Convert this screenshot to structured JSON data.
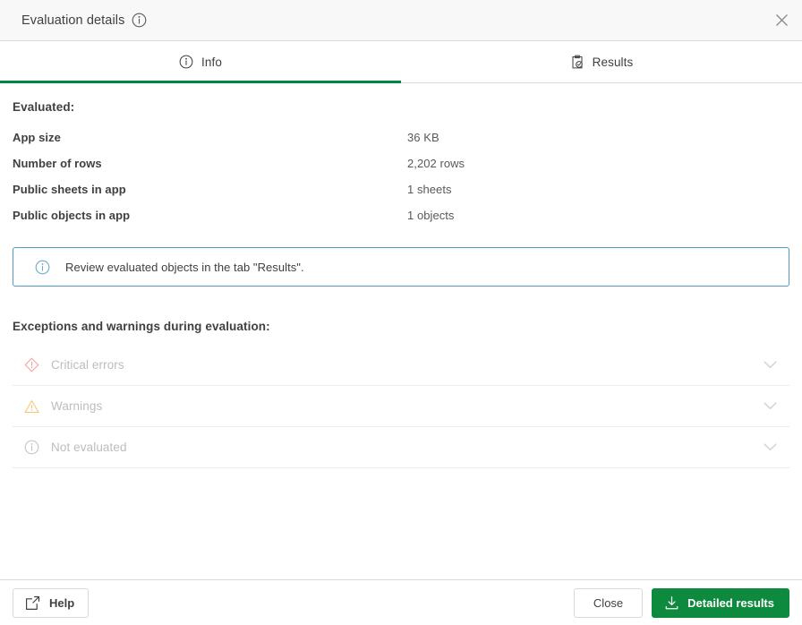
{
  "header": {
    "title": "Evaluation details",
    "info_icon": "info-circle-icon",
    "close_icon": "close-icon"
  },
  "tabs": [
    {
      "label": "Info",
      "icon": "info-circle-icon",
      "active": true
    },
    {
      "label": "Results",
      "icon": "clipboard-check-icon",
      "active": false
    }
  ],
  "main": {
    "evaluated_title": "Evaluated:",
    "metrics": [
      {
        "key": "App size",
        "value": "36 KB"
      },
      {
        "key": "Number of rows",
        "value": "2,202 rows"
      },
      {
        "key": "Public sheets in app",
        "value": "1 sheets"
      },
      {
        "key": "Public objects in app",
        "value": "1 objects"
      }
    ],
    "banner": {
      "icon": "info-circle-icon",
      "text": "Review evaluated objects in the tab \"Results\".",
      "border_color": "#4e9dc4"
    },
    "exceptions_title": "Exceptions and warnings during evaluation:",
    "accordion": [
      {
        "label": "Critical errors",
        "icon": "diamond-alert-icon",
        "icon_color": "#f4a0a0",
        "chevron": "chevron-down-icon"
      },
      {
        "label": "Warnings",
        "icon": "triangle-warning-icon",
        "icon_color": "#f7c66b",
        "chevron": "chevron-down-icon"
      },
      {
        "label": "Not evaluated",
        "icon": "info-circle-icon",
        "icon_color": "#c4c4c4",
        "chevron": "chevron-down-icon"
      }
    ]
  },
  "footer": {
    "help_label": "Help",
    "help_icon": "external-link-icon",
    "close_label": "Close",
    "detailed_label": "Detailed results",
    "detailed_icon": "download-icon",
    "accent_color": "#0e8a3f"
  }
}
